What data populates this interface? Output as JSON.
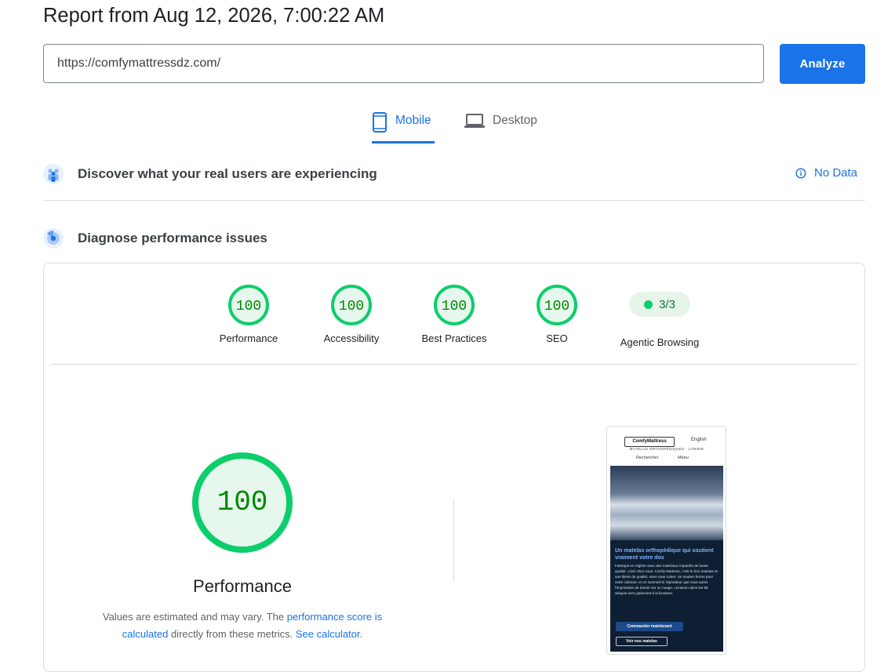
{
  "header": {
    "title": "Report from Aug 12, 2026, 7:00:22 AM"
  },
  "url_bar": {
    "value": "https://comfymattressdz.com/"
  },
  "analyze_label": "Analyze",
  "tabs": [
    {
      "label": "Mobile"
    },
    {
      "label": "Desktop"
    }
  ],
  "field_data": {
    "title": "Discover what your real users are experiencing",
    "status": "No Data"
  },
  "lab_data": {
    "title": "Diagnose performance issues"
  },
  "categories": [
    {
      "label": "Performance",
      "score": "100"
    },
    {
      "label": "Accessibility",
      "score": "100"
    },
    {
      "label": "Best Practices",
      "score": "100"
    },
    {
      "label": "SEO",
      "score": "100"
    }
  ],
  "agentic": {
    "label": "Agentic Browsing",
    "value": "3/3"
  },
  "main_gauge": {
    "score": "100",
    "label": "Performance"
  },
  "note": {
    "prefix": "Values are estimated and may vary. The ",
    "link1": "performance score is calculated",
    "middle": " directly from these metrics. ",
    "link2": "See calculator",
    "suffix": "."
  },
  "screenshot": {
    "logo": "ComfyMattress",
    "lang": "English",
    "tagline": "MATELAS ORTHOPÉDIQUES · LITERIE",
    "nav_search": "Rechercher",
    "nav_menu": "Menu",
    "heading": "Un matelas orthopédique qui soutient vraiment votre dos",
    "body": "Fabriqué en Algérie avec des matériaux importés de haute qualité. Livré chez vous. Comfy Mattress, c'est le bon matelas et une literie de qualité, sans vous ruiner. Un soutien ferme pour votre colonne, et un sommeil si réparateur que vous aurez l'impression de dormir sur un nuage. Livraison dans les 58 wilayas avec paiement à la livraison.",
    "cta_primary": "Commander maintenant",
    "cta_secondary": "Voir nos matelas"
  },
  "colors": {
    "accent": "#1a73e8",
    "pass": "#0cce6b",
    "pass_text": "#008800",
    "pass_bg": "#e6f7ed"
  }
}
